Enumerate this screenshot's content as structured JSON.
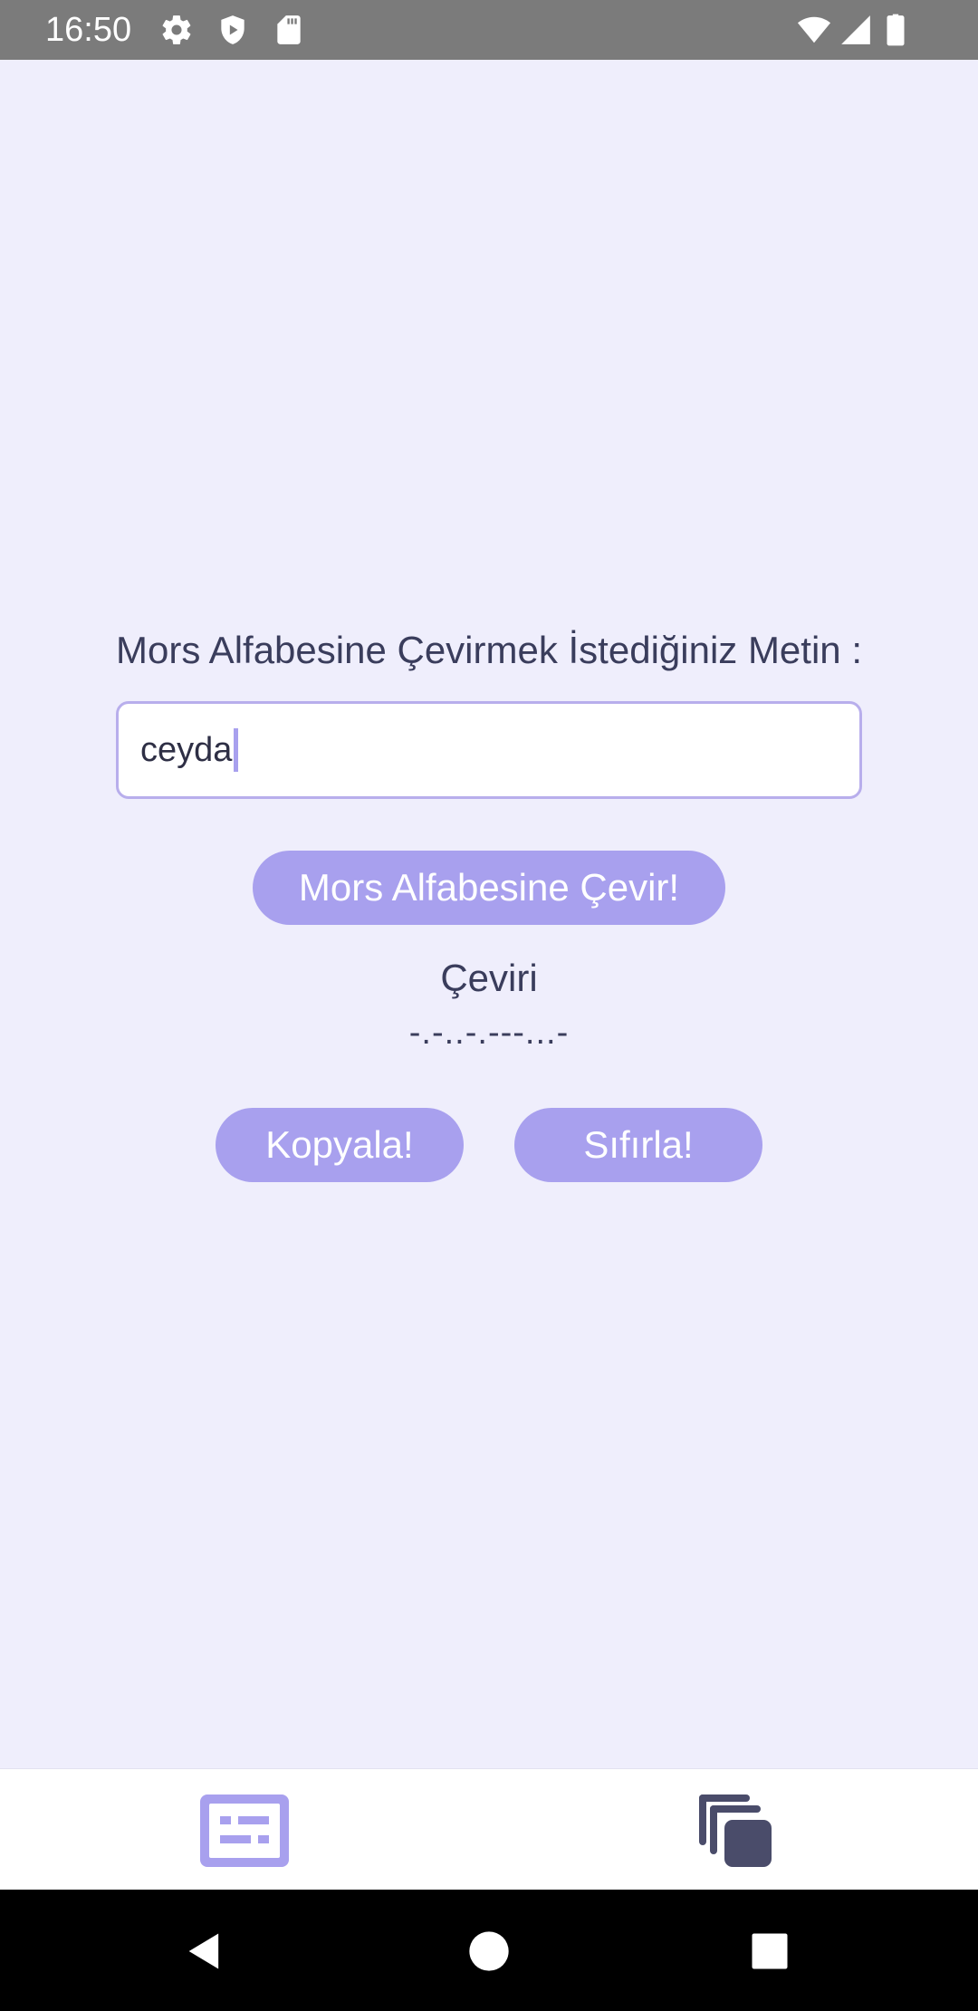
{
  "status_bar": {
    "time": "16:50",
    "icons": [
      "settings-icon",
      "shield-icon",
      "sd-card-icon",
      "wifi-icon",
      "cell-signal-icon",
      "battery-icon"
    ]
  },
  "main": {
    "prompt_label": "Mors Alfabesine Çevirmek İstediğiniz Metin :",
    "input_value": "ceyda",
    "convert_button_label": "Mors Alfabesine Çevir!",
    "result_title": "Çeviri",
    "result_value": "-.-..-.---...-",
    "copy_button_label": "Kopyala!",
    "reset_button_label": "Sıfırla!"
  },
  "bottom_nav": {
    "items": [
      {
        "icon": "translate-card-icon",
        "selected": true
      },
      {
        "icon": "copies-icon",
        "selected": false
      }
    ]
  },
  "colors": {
    "background": "#EFEEFC",
    "accent": "#A8A0EE",
    "text": "#3A3D5C",
    "status_bar": "#7B7B7B",
    "nav_inactive": "#4A4C6A"
  }
}
